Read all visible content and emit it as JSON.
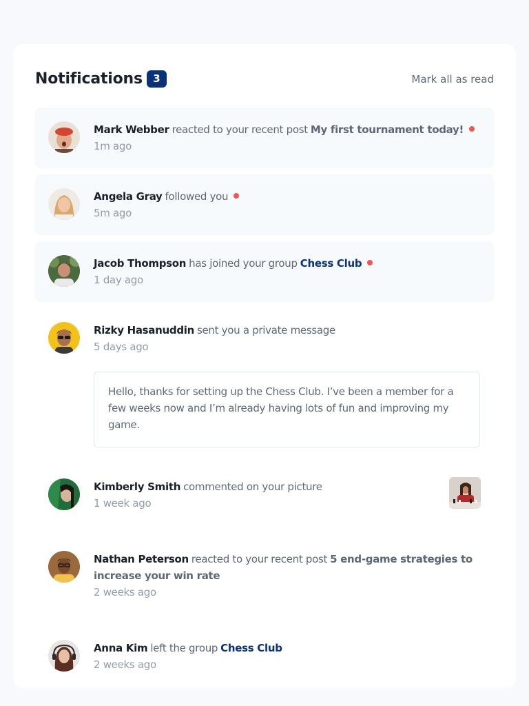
{
  "header": {
    "title": "Notifications",
    "unread_count": "3",
    "mark_all_label": "Mark all as read"
  },
  "colors": {
    "accent": "#0a327b",
    "unread_dot": "#f65552",
    "unread_background": "#f7fafd"
  },
  "notifications": [
    {
      "name": "Mark Webber",
      "action": "reacted to your recent post",
      "post": "My first tournament today!",
      "time": "1m ago",
      "unread": true
    },
    {
      "name": "Angela Gray",
      "action": "followed you",
      "time": "5m ago",
      "unread": true
    },
    {
      "name": "Jacob Thompson",
      "action": "has joined your group",
      "group": "Chess Club",
      "time": "1 day ago",
      "unread": true
    },
    {
      "name": "Rizky Hasanuddin",
      "action": "sent you a private message",
      "time": "5 days ago",
      "unread": false,
      "message": "Hello, thanks for setting up the Chess Club. I’ve been a member for a few weeks now and I’m already having lots of fun and improving my game."
    },
    {
      "name": "Kimberly Smith",
      "action": "commented on your picture",
      "time": "1 week ago",
      "unread": false
    },
    {
      "name": "Nathan Peterson",
      "action": "reacted to your recent post",
      "post": "5 end-game strategies to increase your win rate",
      "time": "2 weeks ago",
      "unread": false
    },
    {
      "name": "Anna Kim",
      "action": "left the group",
      "group": "Chess Club",
      "time": "2 weeks ago",
      "unread": false
    }
  ]
}
